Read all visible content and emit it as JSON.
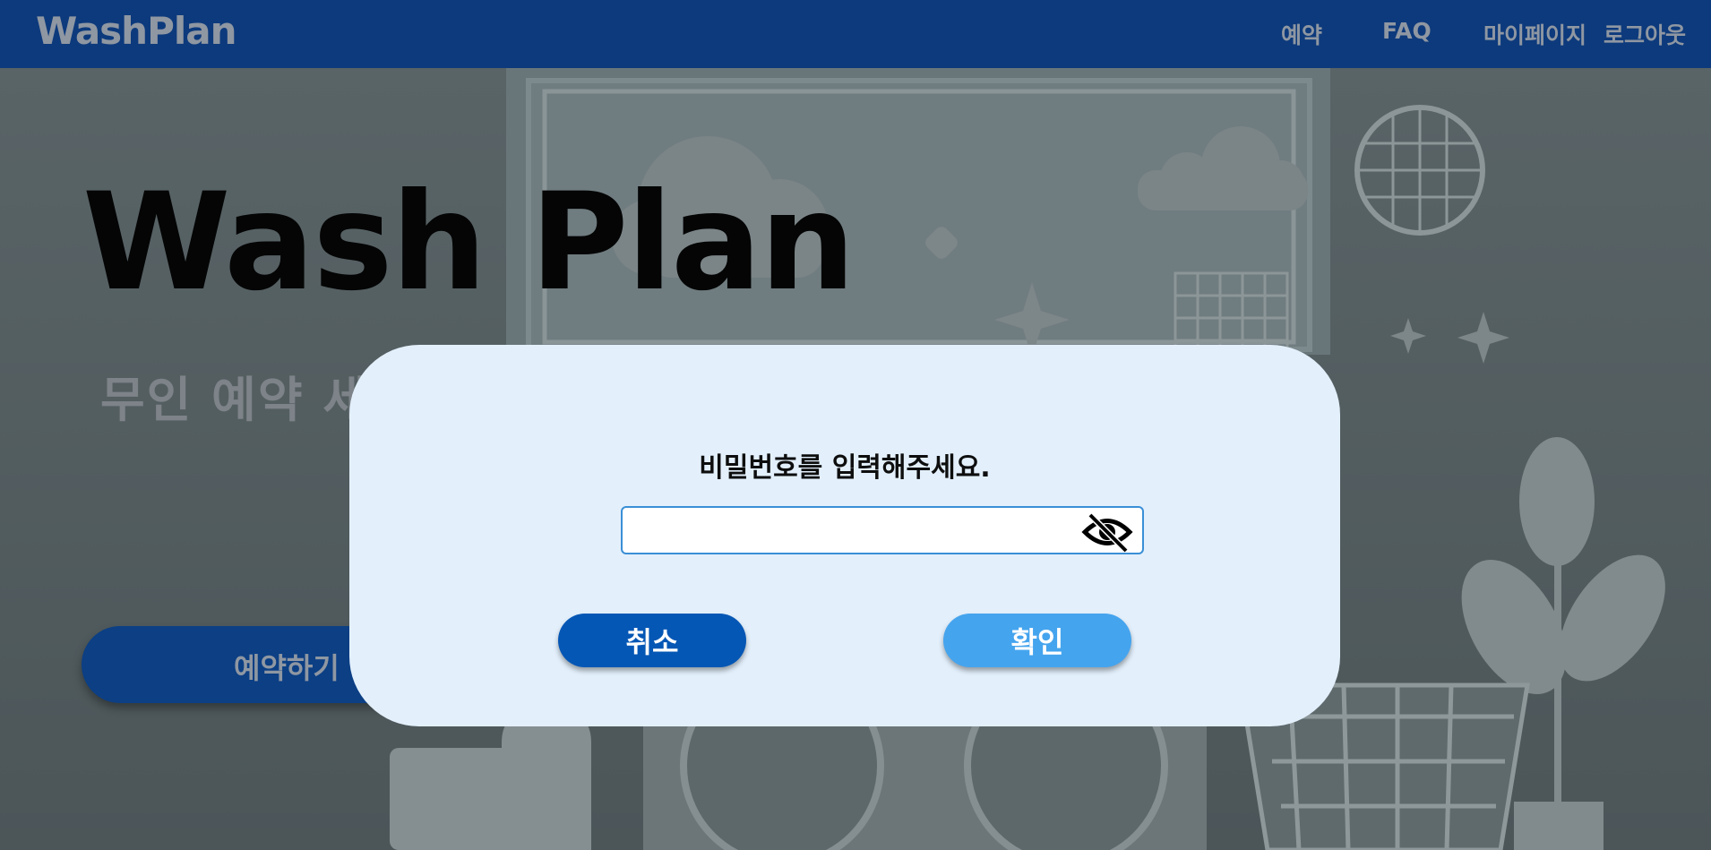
{
  "header": {
    "logo": "WashPlan",
    "nav": {
      "reserve": "예약",
      "faq": "FAQ",
      "mypage": "마이페이지",
      "logout": "로그아웃"
    }
  },
  "hero": {
    "title": "Wash Plan",
    "subtitle": "무인 예약 세",
    "reserve_button": "예약하기"
  },
  "modal": {
    "title": "비밀번호를 입력해주세요.",
    "password_value": "",
    "cancel_label": "취소",
    "confirm_label": "확인"
  },
  "colors": {
    "header_bg": "#0d3a7c",
    "modal_bg": "#e3f0fc",
    "cancel_btn": "#0557b5",
    "confirm_btn": "#45a4ee",
    "input_border": "#3a8fd6"
  }
}
